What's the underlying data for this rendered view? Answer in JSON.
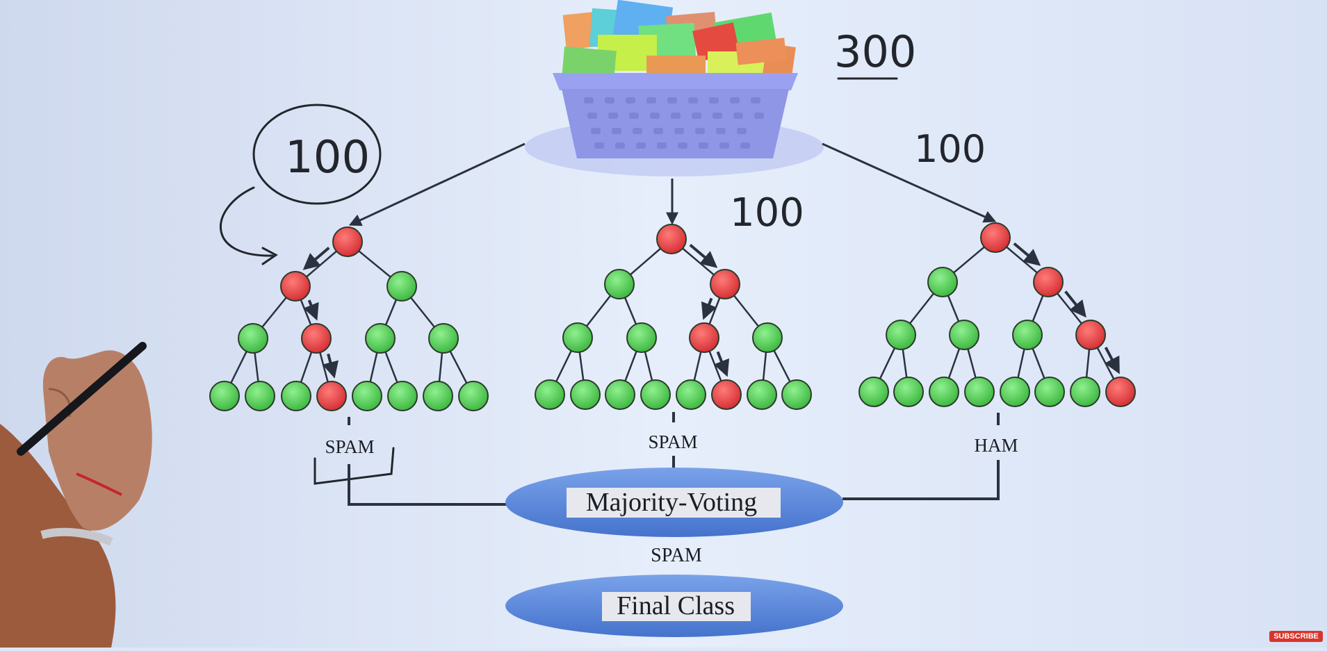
{
  "dataset": {
    "total_count": "300",
    "subset_counts": [
      "100",
      "100",
      "100"
    ]
  },
  "trees": [
    {
      "label": "SPAM",
      "path_color": "red"
    },
    {
      "label": "SPAM",
      "path_color": "red"
    },
    {
      "label": "HAM",
      "path_color": "red"
    }
  ],
  "aggregator": {
    "label": "Majority-Voting"
  },
  "result": {
    "label": "SPAM"
  },
  "final": {
    "label": "Final Class"
  },
  "subscribe_label": "SUBSCRIBE",
  "colors": {
    "background": "#dde7f7",
    "node_green": "#5fd35f",
    "node_red": "#e8464a",
    "ellipse_blue": "#5b86d8",
    "basket": "#8f96e6",
    "connector": "#2a3240"
  }
}
